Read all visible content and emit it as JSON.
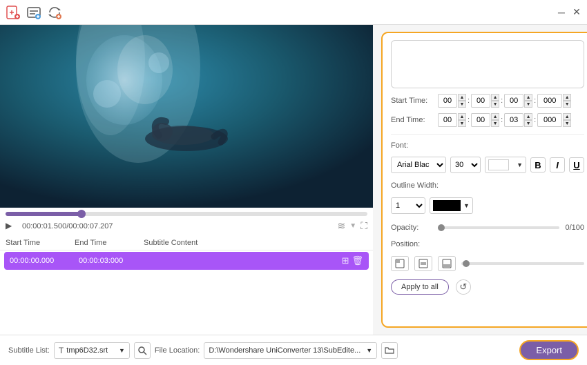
{
  "titlebar": {
    "min_label": "─",
    "close_label": "✕"
  },
  "toolbar": {
    "icon1": "➕",
    "icon2": "🖼",
    "icon3": "🔄"
  },
  "video": {
    "progress_pct": 21
  },
  "playback": {
    "play_icon": "▶",
    "time": "00:00:01.500/00:00:07.207"
  },
  "subtitle_table": {
    "col_start": "Start Time",
    "col_end": "End Time",
    "col_content": "Subtitle Content",
    "rows": [
      {
        "start": "00:00:00.000",
        "end": "00:00:03:000",
        "content": ""
      }
    ]
  },
  "right_panel": {
    "subtitle_text": "",
    "start_time": {
      "h": "00",
      "m": "00",
      "s": "00",
      "ms": "000"
    },
    "end_time": {
      "h": "00",
      "m": "00",
      "s": "03",
      "ms": "000"
    },
    "font_label": "Font:",
    "font_name": "Arial Blac",
    "font_size": "30",
    "bold_label": "B",
    "italic_label": "I",
    "underline_label": "U",
    "outline_label": "Outline Width:",
    "outline_value": "1",
    "opacity_label": "Opacity:",
    "opacity_value": "0/100",
    "position_label": "Position:",
    "apply_label": "Apply to all"
  },
  "bottom": {
    "subtitle_list_label": "Subtitle List:",
    "subtitle_icon": "T",
    "subtitle_file": "tmp6D32.srt",
    "file_location_label": "File Location:",
    "file_path": "D:\\Wondershare UniConverter 13\\SubEdite...",
    "export_label": "Export"
  }
}
